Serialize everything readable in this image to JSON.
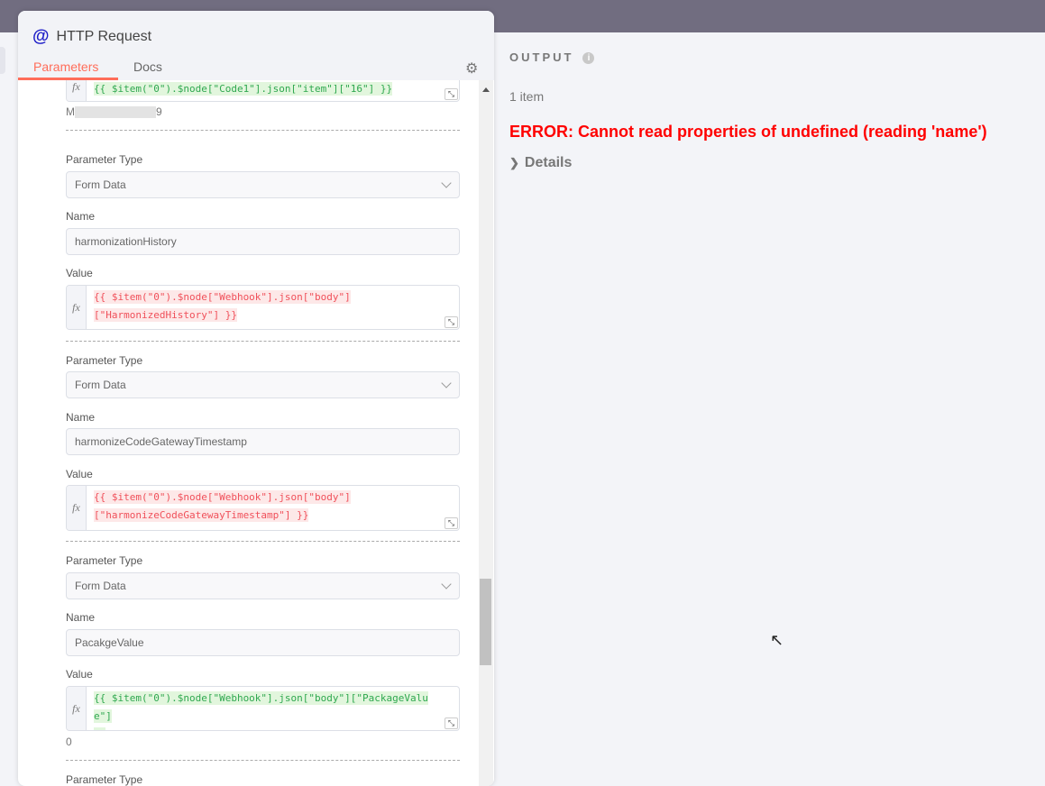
{
  "panel": {
    "title": "HTTP Request",
    "icon": "@",
    "tabs": [
      "Parameters",
      "Docs"
    ]
  },
  "first_value": {
    "expr": "{{ $item(\"0\").$node[\"Code1\"].json[\"item\"][\"16\"] }}",
    "hint_start": "M",
    "hint_end": "9"
  },
  "groups": [
    {
      "type_label": "Parameter Type",
      "type_value": "Form Data",
      "name_label": "Name",
      "name_value": "harmonizationHistory",
      "value_label": "Value",
      "expr_lines": [
        "{{ $item(\"0\").$node[\"Webhook\"].json[\"body\"]",
        "[\"HarmonizedHistory\"] }}"
      ],
      "status": "error"
    },
    {
      "type_label": "Parameter Type",
      "type_value": "Form Data",
      "name_label": "Name",
      "name_value": "harmonizeCodeGatewayTimestamp",
      "value_label": "Value",
      "expr_lines": [
        "{{ $item(\"0\").$node[\"Webhook\"].json[\"body\"]",
        "[\"harmonizeCodeGatewayTimestamp\"] }}"
      ],
      "status": "error"
    },
    {
      "type_label": "Parameter Type",
      "type_value": "Form Data",
      "name_label": "Name",
      "name_value": "PacakgeValue",
      "value_label": "Value",
      "expr_lines": [
        "{{ $item(\"0\").$node[\"Webhook\"].json[\"body\"][\"PackageValue\"]",
        "}}"
      ],
      "status": "ok",
      "hint": "0"
    }
  ],
  "last_label": "Parameter Type",
  "output": {
    "heading": "OUTPUT",
    "count": "1 item",
    "error": "ERROR: Cannot read properties of undefined (reading 'name')",
    "details": "Details"
  }
}
